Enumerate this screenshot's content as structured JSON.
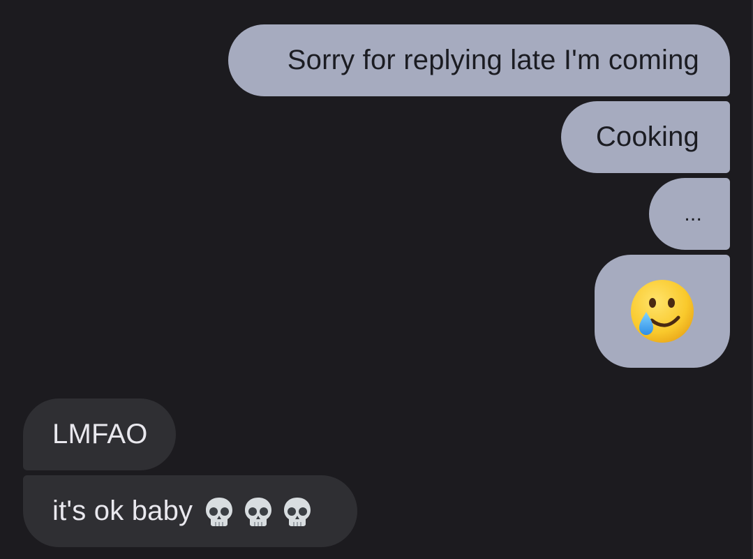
{
  "messages": [
    {
      "direction": "outgoing",
      "text": "Sorry for replying late I'm coming"
    },
    {
      "direction": "outgoing",
      "text": "Cooking"
    },
    {
      "direction": "outgoing",
      "text": "..."
    },
    {
      "direction": "outgoing",
      "emoji": "smiling-face-with-tear"
    },
    {
      "direction": "incoming",
      "text": "LMFAO"
    },
    {
      "direction": "incoming",
      "text": "it's ok baby",
      "emoji": [
        "skull",
        "skull",
        "skull"
      ]
    }
  ],
  "colors": {
    "background": "#1c1b1f",
    "outgoing_bubble": "#a6abbf",
    "incoming_bubble": "#2f2f33",
    "outgoing_text": "#1b1c22",
    "incoming_text": "#e9e8ee"
  }
}
